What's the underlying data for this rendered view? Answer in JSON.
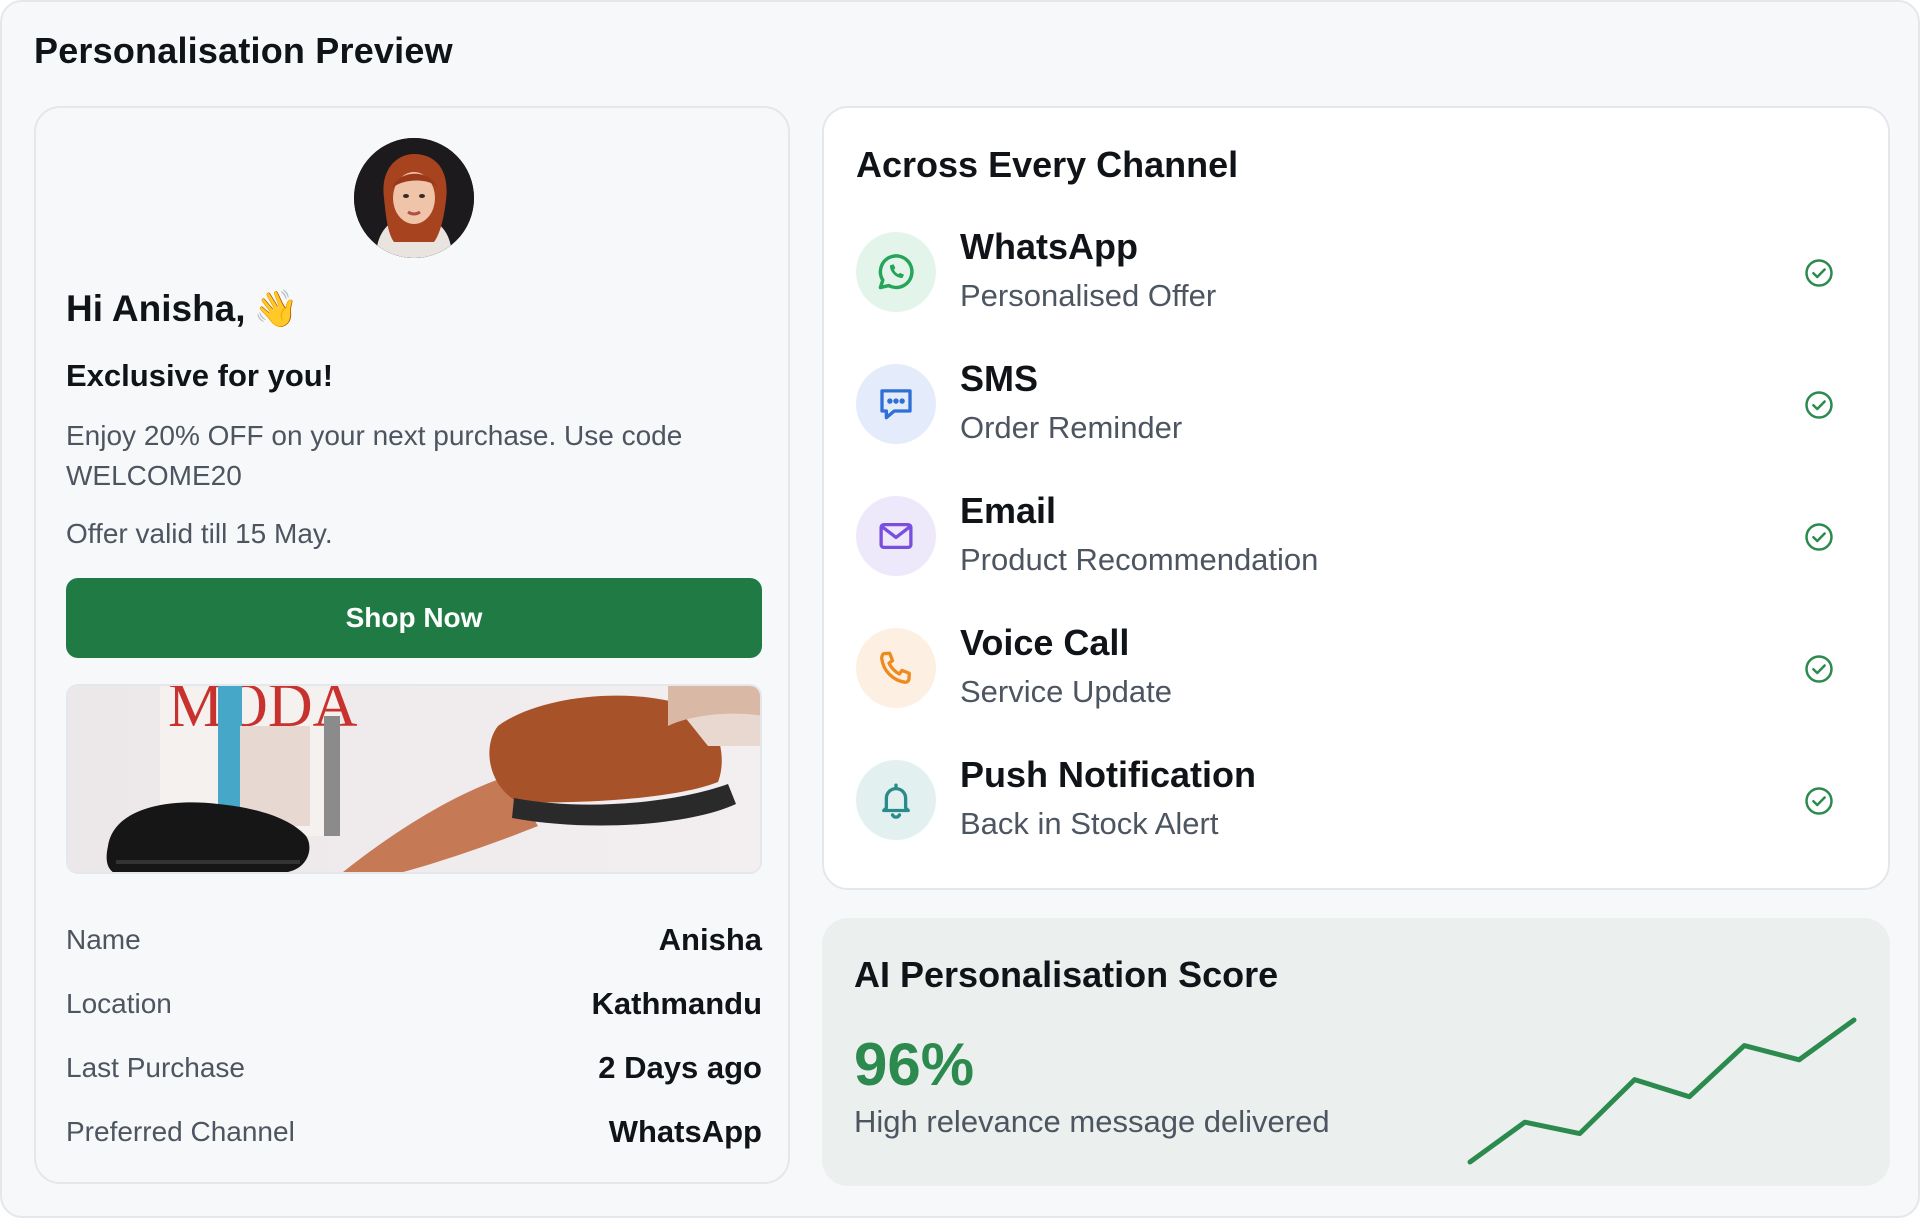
{
  "page": {
    "title": "Personalisation Preview"
  },
  "preview": {
    "greeting": "Hi Anisha,",
    "wave_emoji": "👋",
    "subtitle": "Exclusive for you!",
    "body": "Enjoy 20% OFF on your next purchase. Use code WELCOME20",
    "validity": "Offer valid till 15 May.",
    "cta_label": "Shop Now",
    "banner_text": "MODA",
    "details": [
      {
        "label": "Name",
        "value": "Anisha"
      },
      {
        "label": "Location",
        "value": "Kathmandu"
      },
      {
        "label": "Last Purchase",
        "value": "2 Days ago"
      },
      {
        "label": "Preferred Channel",
        "value": "WhatsApp"
      }
    ]
  },
  "channels": {
    "title": "Across Every Channel",
    "items": [
      {
        "name": "WhatsApp",
        "description": "Personalised Offer",
        "icon": "whatsapp-icon",
        "color": "#25a45a",
        "bg": "#e3f5ea"
      },
      {
        "name": "SMS",
        "description": "Order Reminder",
        "icon": "chat-bubble-icon",
        "color": "#2f6fd8",
        "bg": "#e4ecfb"
      },
      {
        "name": "Email",
        "description": "Product Recommendation",
        "icon": "mail-icon",
        "color": "#7a4fe0",
        "bg": "#eee8fb"
      },
      {
        "name": "Voice Call",
        "description": "Service Update",
        "icon": "phone-icon",
        "color": "#ef8a1e",
        "bg": "#fdf0e2"
      },
      {
        "name": "Push Notification",
        "description": "Back in Stock Alert",
        "icon": "bell-icon",
        "color": "#2b8a8a",
        "bg": "#e2f1f0"
      }
    ],
    "check_color": "#2d8a4e"
  },
  "score": {
    "title": "AI Personalisation Score",
    "value": "96%",
    "description": "High relevance message delivered",
    "trend": [
      0,
      0.28,
      0.2,
      0.58,
      0.46,
      0.82,
      0.72,
      1.0
    ],
    "trend_color": "#2d8a4e"
  },
  "colors": {
    "accent": "#1f7a44",
    "background": "#f7f8fa"
  }
}
